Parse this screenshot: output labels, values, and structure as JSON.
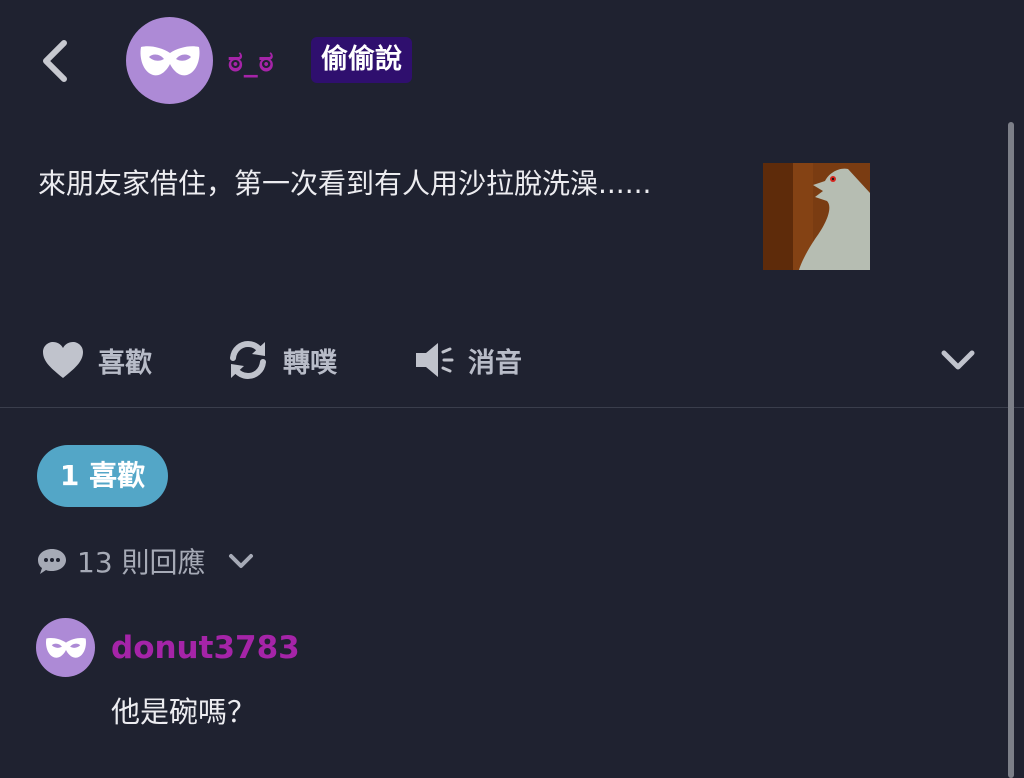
{
  "header": {
    "username": "ಠ_ಠ",
    "badge": "偷偷說"
  },
  "post": {
    "text": "來朋友家借住，第一次看到有人用沙拉脫洗澡......"
  },
  "actions": {
    "like_label": "喜歡",
    "repost_label": "轉噗",
    "mute_label": "消音"
  },
  "likes": {
    "label": "1 喜歡"
  },
  "replies": {
    "label": "13 則回應"
  },
  "comment": {
    "username": "donut3783",
    "text": "他是碗嗎？"
  },
  "colors": {
    "background": "#1f2230",
    "avatar": "#ad8ad6",
    "username": "#a524a8",
    "badge": "#2f0f6e",
    "likes_pill": "#53a6c7"
  }
}
